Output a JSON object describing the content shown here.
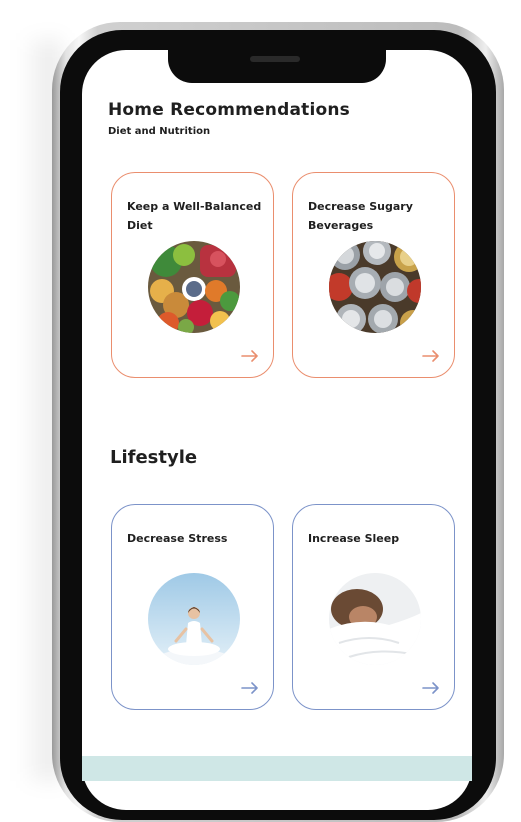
{
  "header": {
    "title": "Home Recommendations",
    "subtitle": "Diet and Nutrition"
  },
  "diet_cards": [
    {
      "label": "Keep a Well-Balanced Diet",
      "image": "healthy-food-bowl-illustration",
      "arrow_icon": "arrow-right-icon"
    },
    {
      "label": "Decrease Sugary Beverages",
      "image": "soda-cans-illustration",
      "arrow_icon": "arrow-right-icon"
    }
  ],
  "lifestyle": {
    "title": "Lifestyle",
    "cards": [
      {
        "label": "Decrease Stress",
        "image": "meditation-person-illustration",
        "arrow_icon": "arrow-right-icon"
      },
      {
        "label": "Increase Sleep",
        "image": "sleeping-person-illustration",
        "arrow_icon": "arrow-right-icon"
      }
    ]
  },
  "colors": {
    "diet_accent": "#ea8e6e",
    "lifestyle_accent": "#7c93c9",
    "text": "#1f1f1f",
    "bottom_band": "#cfe7e6"
  }
}
